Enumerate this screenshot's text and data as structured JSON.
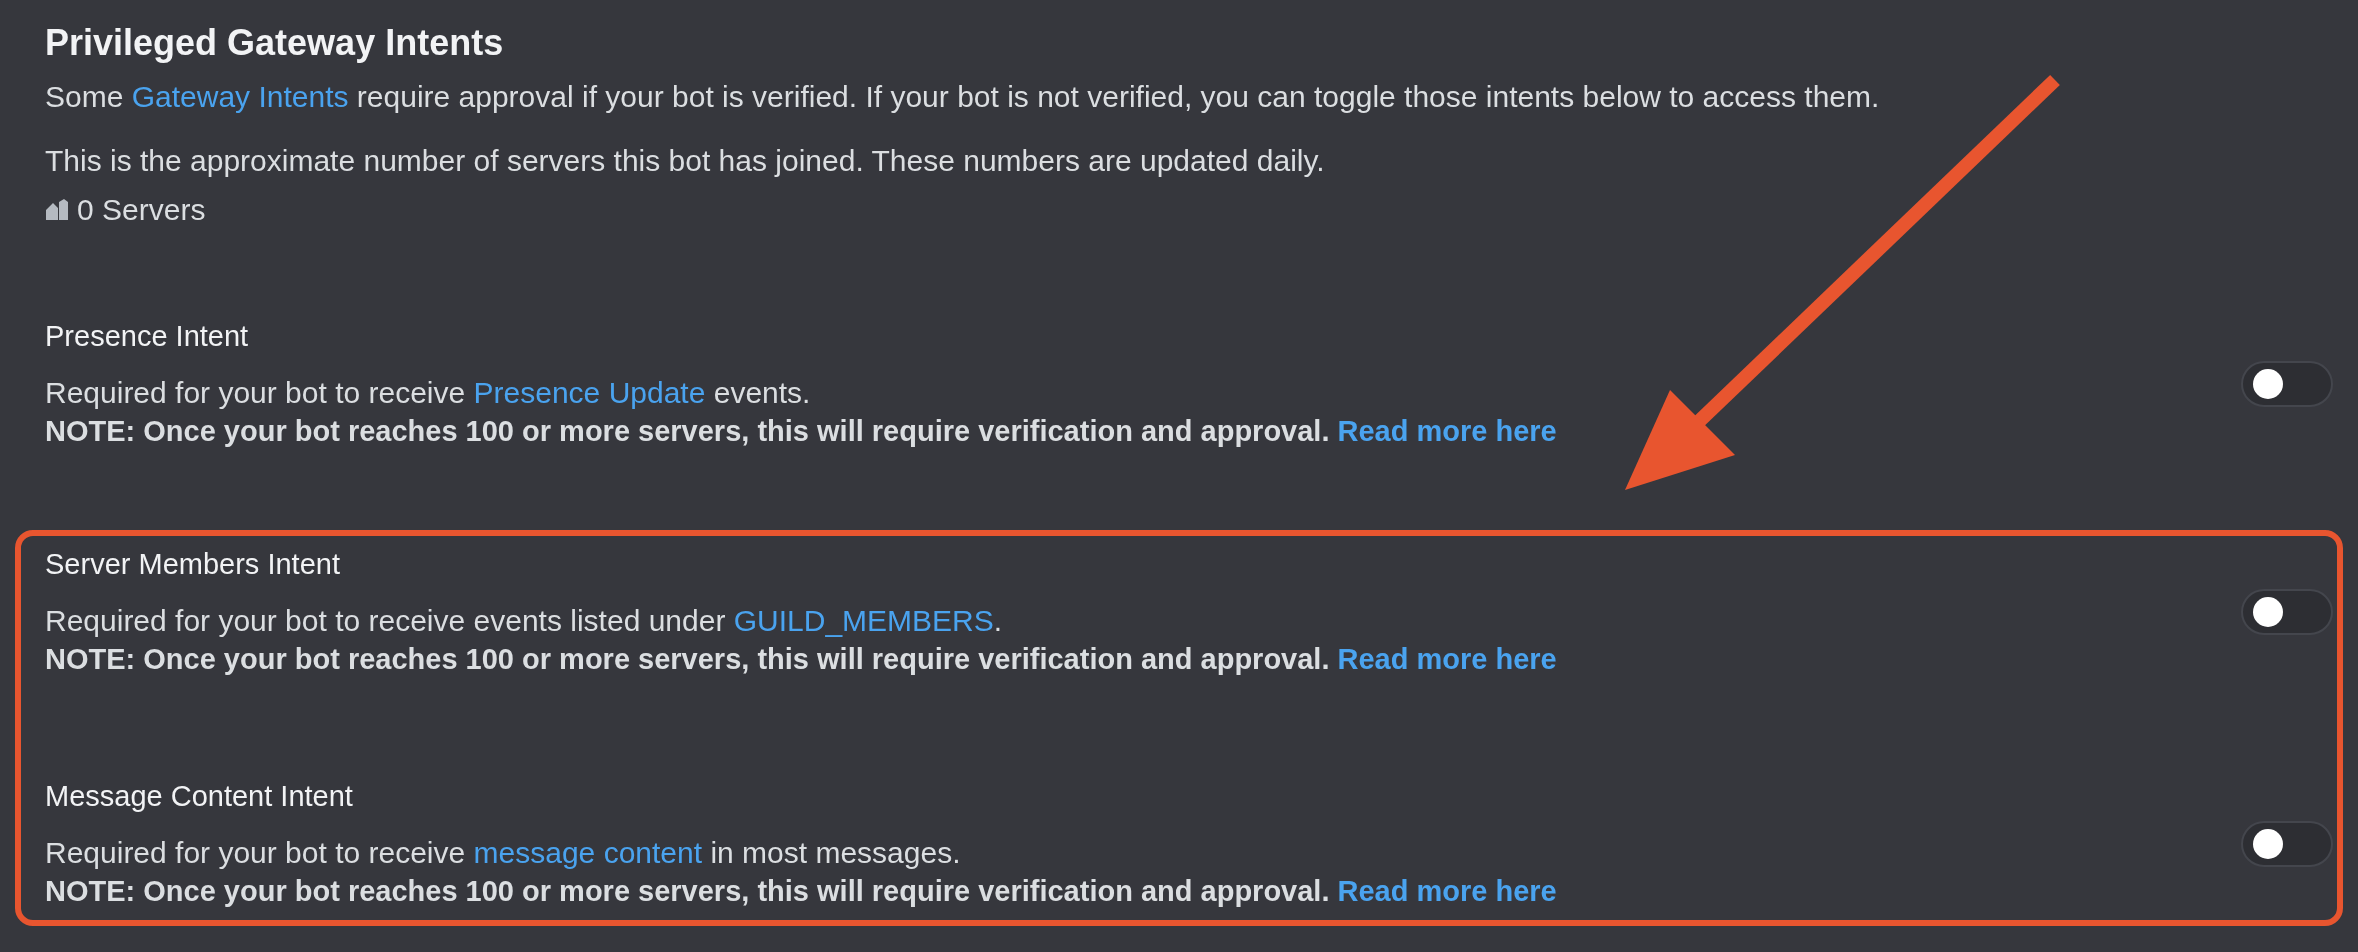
{
  "section": {
    "title": "Privileged Gateway Intents",
    "description": {
      "before": "Some ",
      "link": "Gateway Intents",
      "after": " require approval if your bot is verified. If your bot is not verified, you can toggle those intents below to access them."
    },
    "server_note": "This is the approximate number of servers this bot has joined. These numbers are updated daily.",
    "server_count": "0 Servers"
  },
  "intents": [
    {
      "title": "Presence Intent",
      "description": {
        "before": "Required for your bot to receive ",
        "link": "Presence Update",
        "after": " events."
      },
      "note": {
        "text": "NOTE: Once your bot reaches 100 or more servers, this will require verification and approval.",
        "link": "Read more here"
      },
      "on": false,
      "highlighted": false
    },
    {
      "title": "Server Members Intent",
      "description": {
        "before": "Required for your bot to receive events listed under ",
        "link": "GUILD_MEMBERS",
        "after": "."
      },
      "note": {
        "text": "NOTE: Once your bot reaches 100 or more servers, this will require verification and approval.",
        "link": "Read more here"
      },
      "on": false,
      "highlighted": true
    },
    {
      "title": "Message Content Intent",
      "description": {
        "before": "Required for your bot to receive ",
        "link": "message content",
        "after": " in most messages."
      },
      "note": {
        "text": "NOTE: Once your bot reaches 100 or more servers, this will require verification and approval.",
        "link": "Read more here"
      },
      "on": false,
      "highlighted": true
    }
  ]
}
